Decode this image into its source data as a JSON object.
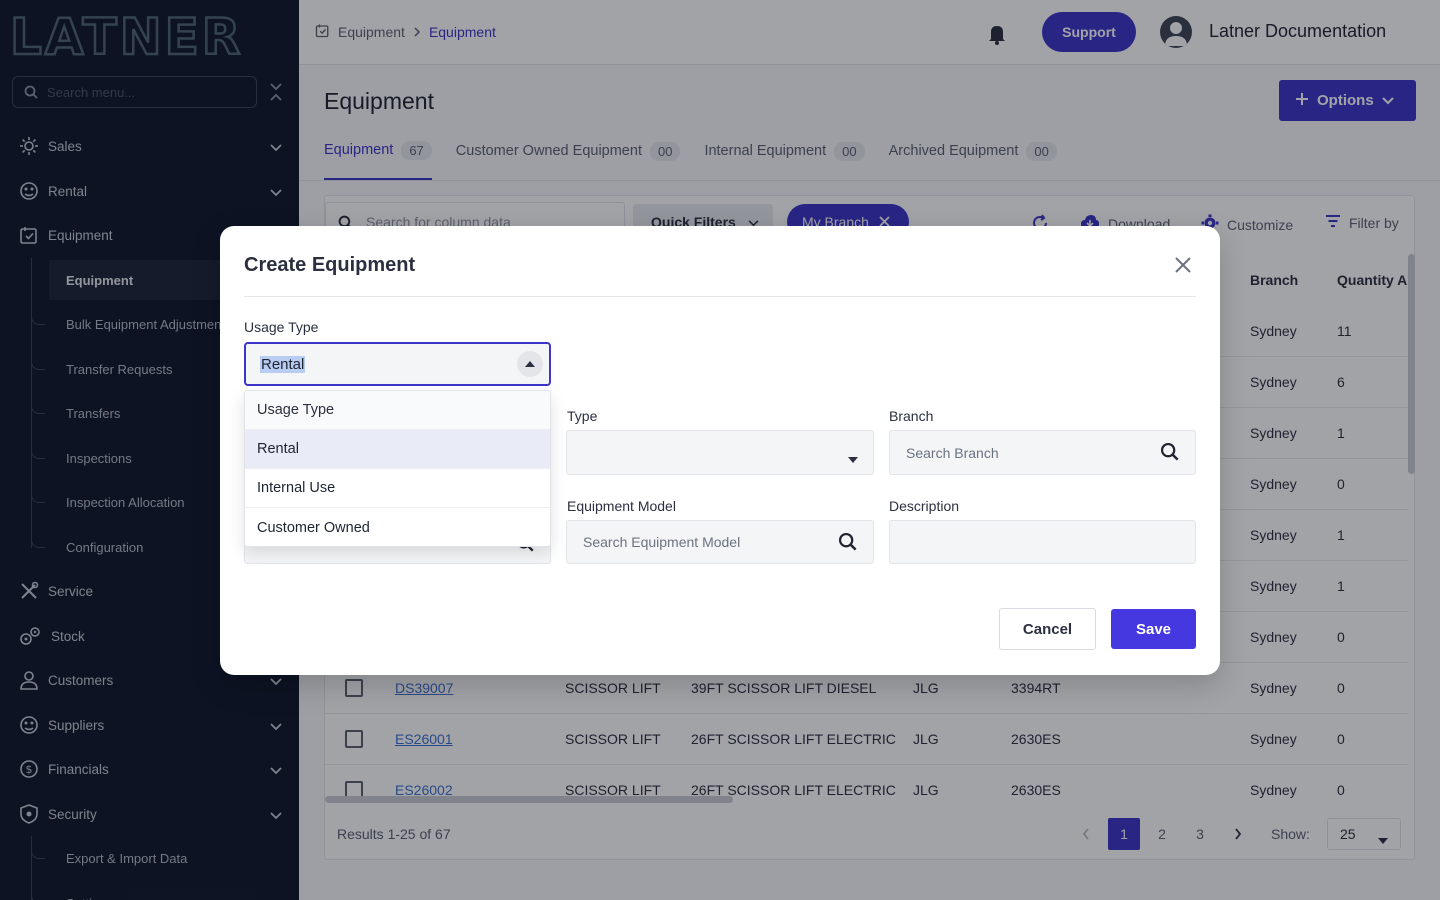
{
  "brand": {
    "logo_text": "LATNER"
  },
  "sidebar": {
    "search_placeholder": "Search menu...",
    "items": [
      {
        "label": "Sales"
      },
      {
        "label": "Rental"
      },
      {
        "label": "Equipment"
      },
      {
        "label": "Service"
      },
      {
        "label": "Stock"
      },
      {
        "label": "Customers"
      },
      {
        "label": "Suppliers"
      },
      {
        "label": "Financials"
      },
      {
        "label": "Security"
      }
    ],
    "equipment_sub": [
      {
        "label": "Equipment",
        "active": true
      },
      {
        "label": "Bulk Equipment Adjustment"
      },
      {
        "label": "Transfer Requests"
      },
      {
        "label": "Transfers"
      },
      {
        "label": "Inspections"
      },
      {
        "label": "Inspection Allocation"
      },
      {
        "label": "Configuration"
      }
    ],
    "security_sub": [
      {
        "label": "Export & Import Data"
      },
      {
        "label": "Settings"
      }
    ]
  },
  "header": {
    "breadcrumb": [
      "Equipment",
      "Equipment"
    ],
    "support_label": "Support",
    "user_name": "Latner Documentation"
  },
  "page": {
    "title": "Equipment",
    "options_label": "Options",
    "tabs": [
      {
        "label": "Equipment",
        "count": "67"
      },
      {
        "label": "Customer Owned Equipment",
        "count": "00"
      },
      {
        "label": "Internal Equipment",
        "count": "00"
      },
      {
        "label": "Archived Equipment",
        "count": "00"
      }
    ]
  },
  "table": {
    "search_placeholder": "Search for column data",
    "quick_filters_label": "Quick Filters",
    "branch_chip_label": "My Branch",
    "download_label": "Download",
    "customize_label": "Customize",
    "filter_label": "Filter by",
    "columns": {
      "branch": "Branch",
      "quantity": "Quantity A"
    },
    "background_rows": [
      {
        "branch": "Sydney",
        "qty": "11"
      },
      {
        "branch": "Sydney",
        "qty": "6"
      },
      {
        "branch": "Sydney",
        "qty": "1"
      },
      {
        "branch": "Sydney",
        "qty": "0"
      },
      {
        "branch": "Sydney",
        "qty": "1"
      },
      {
        "branch": "Sydney",
        "qty": "1"
      },
      {
        "branch": "Sydney",
        "qty": "0"
      }
    ],
    "rows": [
      {
        "id": "DS39007",
        "category": "SCISSOR LIFT",
        "description": "39FT SCISSOR LIFT DIESEL",
        "make": "JLG",
        "model": "3394RT",
        "branch": "Sydney",
        "qty": "0"
      },
      {
        "id": "ES26001",
        "category": "SCISSOR LIFT",
        "description": "26FT SCISSOR LIFT ELECTRIC",
        "make": "JLG",
        "model": "2630ES",
        "branch": "Sydney",
        "qty": "0"
      },
      {
        "id": "ES26002",
        "category": "SCISSOR LIFT",
        "description": "26FT SCISSOR LIFT ELECTRIC",
        "make": "JLG",
        "model": "2630ES",
        "branch": "Sydney",
        "qty": "0"
      }
    ],
    "results_text": "Results 1-25 of 67",
    "pages": [
      "1",
      "2",
      "3"
    ],
    "show_label": "Show:",
    "page_size": "25"
  },
  "modal": {
    "title": "Create Equipment",
    "usage_type_label": "Usage Type",
    "usage_type_value": "Rental",
    "usage_options": [
      "Usage Type",
      "Rental",
      "Internal Use",
      "Customer Owned"
    ],
    "type_label": "Type",
    "type_value": "",
    "branch_label": "Branch",
    "branch_placeholder": "Search Branch",
    "equipment_model_label": "Equipment Model",
    "equipment_model_placeholder": "Search Equipment Model",
    "description_label": "Description",
    "description_value": "",
    "cancel_label": "Cancel",
    "save_label": "Save"
  },
  "colors": {
    "accent": "#3d35c9",
    "sidebar_bg": "#10182b",
    "save_button": "#4538e0"
  },
  "icons": {
    "search": "search-icon",
    "bell": "bell-icon",
    "close": "close-icon",
    "plus": "plus-icon",
    "refresh": "refresh-icon",
    "download": "cloud-download-icon",
    "gear": "gear-icon",
    "filter": "filter-icon"
  }
}
